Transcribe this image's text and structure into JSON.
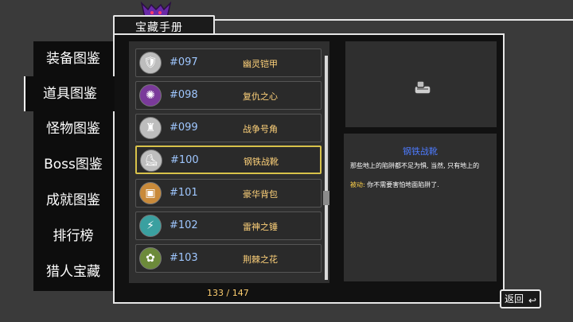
{
  "header": {
    "title": "宝藏手册"
  },
  "menu": {
    "items": [
      {
        "label": "装备图鉴"
      },
      {
        "label": "道具图鉴"
      },
      {
        "label": "怪物图鉴"
      },
      {
        "label": "Boss图鉴"
      },
      {
        "label": "成就图鉴"
      },
      {
        "label": "排行榜"
      },
      {
        "label": "猎人宝藏"
      }
    ],
    "active_index": 1
  },
  "items": [
    {
      "num": "#097",
      "name": "幽灵铠甲",
      "icon": "ghost-armor-icon"
    },
    {
      "num": "#098",
      "name": "复仇之心",
      "icon": "vengeance-heart-icon"
    },
    {
      "num": "#099",
      "name": "战争号角",
      "icon": "war-horn-icon"
    },
    {
      "num": "#100",
      "name": "钢铁战靴",
      "icon": "iron-boots-icon"
    },
    {
      "num": "#101",
      "name": "豪华背包",
      "icon": "backpack-icon"
    },
    {
      "num": "#102",
      "name": "雷神之锤",
      "icon": "thor-hammer-icon"
    },
    {
      "num": "#103",
      "name": "荆棘之花",
      "icon": "thorn-flower-icon"
    }
  ],
  "selected_index": 3,
  "counter": "133 / 147",
  "detail": {
    "title": "钢铁战靴",
    "text": "那些地上的陷阱都不足为惧, 当然, 只有地上的",
    "passive_label": "被动:",
    "passive_text": " 你不需要害怕地面陷阱了."
  },
  "back_button": {
    "label": "返回"
  },
  "colors": {
    "accent_yellow": "#d8c24a",
    "item_number": "#9fc7ff",
    "item_name": "#ffd27a",
    "detail_title": "#4d7bff"
  }
}
